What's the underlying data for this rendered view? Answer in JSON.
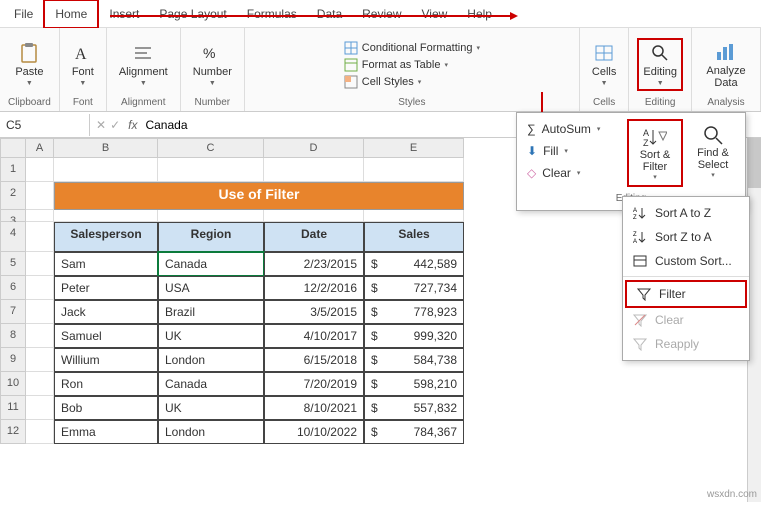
{
  "tabs": {
    "file": "File",
    "home": "Home",
    "insert": "Insert",
    "pagelayout": "Page Layout",
    "formulas": "Formulas",
    "data": "Data",
    "review": "Review",
    "view": "View",
    "help": "Help"
  },
  "ribbon": {
    "clipboard": {
      "paste": "Paste",
      "title": "Clipboard"
    },
    "font": {
      "btn": "Font",
      "title": "Font"
    },
    "alignment": {
      "btn": "Alignment",
      "title": "Alignment"
    },
    "number": {
      "btn": "Number",
      "title": "Number"
    },
    "styles": {
      "cond": "Conditional Formatting",
      "table": "Format as Table",
      "cellstyles": "Cell Styles",
      "title": "Styles"
    },
    "cells": {
      "btn": "Cells",
      "title": "Cells"
    },
    "editing": {
      "btn": "Editing",
      "title": "Editing"
    },
    "analysis": {
      "btn": "Analyze Data",
      "title": "Analysis"
    }
  },
  "namebox": "C5",
  "formula": "Canada",
  "sheet": {
    "banner": "Use of Filter",
    "headers": {
      "salesperson": "Salesperson",
      "region": "Region",
      "date": "Date",
      "sales": "Sales"
    },
    "rows": [
      {
        "sp": "Sam",
        "rg": "Canada",
        "dt": "2/23/2015",
        "sl": "442,589"
      },
      {
        "sp": "Peter",
        "rg": "USA",
        "dt": "12/2/2016",
        "sl": "727,734"
      },
      {
        "sp": "Jack",
        "rg": "Brazil",
        "dt": "3/5/2015",
        "sl": "778,923"
      },
      {
        "sp": "Samuel",
        "rg": "UK",
        "dt": "4/10/2017",
        "sl": "999,320"
      },
      {
        "sp": "Willium",
        "rg": "London",
        "dt": "6/15/2018",
        "sl": "584,738"
      },
      {
        "sp": "Ron",
        "rg": "Canada",
        "dt": "7/20/2019",
        "sl": "598,210"
      },
      {
        "sp": "Bob",
        "rg": "UK",
        "dt": "8/10/2021",
        "sl": "557,832"
      },
      {
        "sp": "Emma",
        "rg": "London",
        "dt": "10/10/2022",
        "sl": "784,367"
      }
    ],
    "currency": "$",
    "cols": [
      "A",
      "B",
      "C",
      "D",
      "E"
    ],
    "rownums": [
      "1",
      "2",
      "3",
      "4",
      "5",
      "6",
      "7",
      "8",
      "9",
      "10",
      "11",
      "12"
    ]
  },
  "dd1": {
    "autosum": "AutoSum",
    "fill": "Fill",
    "clear": "Clear",
    "sortfilter": "Sort & Filter",
    "findselect": "Find & Select",
    "foot": "Editing"
  },
  "dd2": {
    "sortaz": "Sort A to Z",
    "sortza": "Sort Z to A",
    "custom": "Custom Sort...",
    "filter": "Filter",
    "clear": "Clear",
    "reapply": "Reapply"
  },
  "watermark": "wsxdn.com"
}
